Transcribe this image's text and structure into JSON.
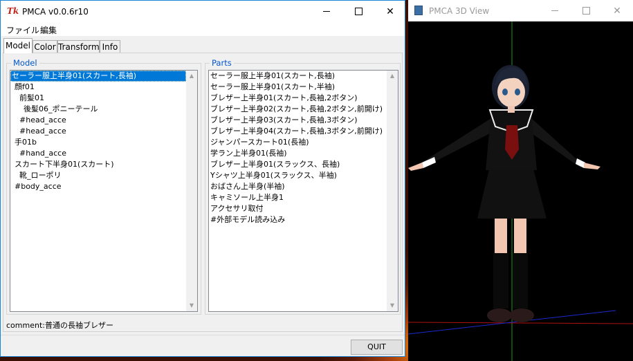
{
  "main_window": {
    "title": "PMCA v0.0.6r10",
    "menu": [
      "ファイル",
      "編集"
    ],
    "tabs": [
      "Model",
      "Color",
      "Transform",
      "Info"
    ],
    "model_group_label": "Model",
    "parts_group_label": "Parts",
    "model_tree": [
      "セーラー服上半身01(スカート,長袖)",
      "顔f01",
      "前髪01",
      "後髪06_ポニーテール",
      "#head_acce",
      "#head_acce",
      "手01b",
      "#hand_acce",
      "スカート下半身01(スカート)",
      "靴_ローポリ",
      "#body_acce"
    ],
    "parts_list": [
      "セーラー服上半身01(スカート,長袖)",
      "セーラー服上半身01(スカート,半袖)",
      "ブレザー上半身01(スカート,長袖,2ボタン)",
      "ブレザー上半身02(スカート,長袖,2ボタン,前開け)",
      "ブレザー上半身03(スカート,長袖,3ボタン)",
      "ブレザー上半身04(スカート,長袖,3ボタン,前開け)",
      "ジャンパースカート01(長袖)",
      "学ラン上半身01(長袖)",
      "ブレザー上半身01(スラックス、長袖)",
      "Yシャツ上半身01(スラックス、半袖)",
      "おばさん上半身(半袖)",
      "キャミソール上半身1",
      "アクセサリ取付",
      "#外部モデル読み込み"
    ],
    "comment": "comment:普通の長袖ブレザー",
    "quit_label": "QUIT"
  },
  "view_window": {
    "title": "PMCA 3D View"
  },
  "icons": {
    "app": "tk-feather-icon",
    "minimize": "minimize-icon",
    "maximize": "maximize-icon",
    "close": "close-icon"
  },
  "colors": {
    "accent": "#0078d7",
    "group_label": "#0055cc",
    "viewport_bg": "#000000"
  }
}
